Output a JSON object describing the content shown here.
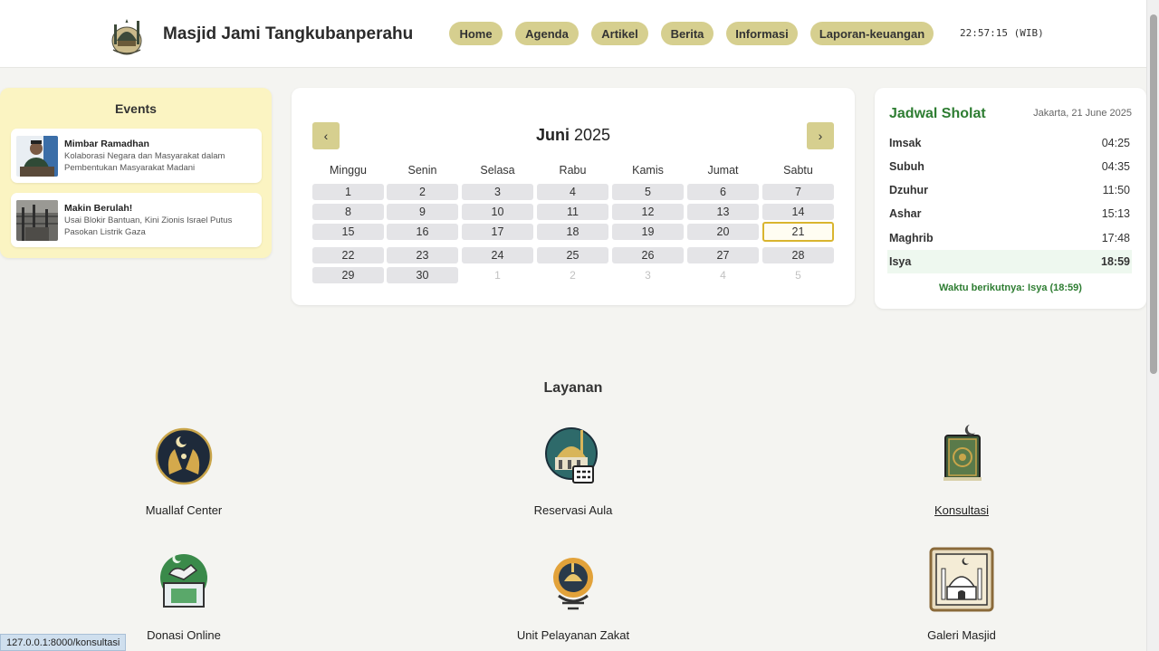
{
  "header": {
    "site_title": "Masjid Jami Tangkubanperahu",
    "nav": [
      "Home",
      "Agenda",
      "Artikel",
      "Berita",
      "Informasi",
      "Laporan-keuangan"
    ],
    "clock": "22:57:15 (WIB)"
  },
  "events": {
    "title": "Events",
    "items": [
      {
        "title": "Mimbar Ramadhan",
        "desc": "Kolaborasi Negara dan Masyarakat dalam Pembentukan Masyarakat Madani"
      },
      {
        "title": "Makin Berulah!",
        "desc": "Usai Blokir Bantuan, Kini Zionis Israel Putus Pasokan Listrik Gaza"
      }
    ]
  },
  "calendar": {
    "month": "Juni",
    "year": "2025",
    "prev_label": "‹",
    "next_label": "›",
    "weekdays": [
      "Minggu",
      "Senin",
      "Selasa",
      "Rabu",
      "Kamis",
      "Jumat",
      "Sabtu"
    ],
    "days": [
      "1",
      "2",
      "3",
      "4",
      "5",
      "6",
      "7",
      "8",
      "9",
      "10",
      "11",
      "12",
      "13",
      "14",
      "15",
      "16",
      "17",
      "18",
      "19",
      "20",
      "21",
      "22",
      "23",
      "24",
      "25",
      "26",
      "27",
      "28",
      "29",
      "30"
    ],
    "trailing_days": [
      "1",
      "2",
      "3",
      "4",
      "5"
    ],
    "today": "21"
  },
  "prayer": {
    "title": "Jadwal Sholat",
    "date": "Jakarta, 21 June 2025",
    "times": [
      {
        "name": "Imsak",
        "time": "04:25"
      },
      {
        "name": "Subuh",
        "time": "04:35"
      },
      {
        "name": "Dzuhur",
        "time": "11:50"
      },
      {
        "name": "Ashar",
        "time": "15:13"
      },
      {
        "name": "Maghrib",
        "time": "17:48"
      },
      {
        "name": "Isya",
        "time": "18:59"
      }
    ],
    "active": "Isya",
    "next": "Waktu berikutnya: Isya (18:59)"
  },
  "layanan": {
    "title": "Layanan",
    "items": [
      "Muallaf Center",
      "Reservasi Aula",
      "Konsultasi",
      "Donasi Online",
      "Unit Pelayanan Zakat",
      "Galeri Masjid"
    ]
  },
  "status_url": "127.0.0.1:8000/konsultasi",
  "colors": {
    "accent": "#d6cf8f",
    "green": "#2e7d32",
    "events_bg": "#fbf4c2",
    "today_border": "#d9b52f"
  }
}
